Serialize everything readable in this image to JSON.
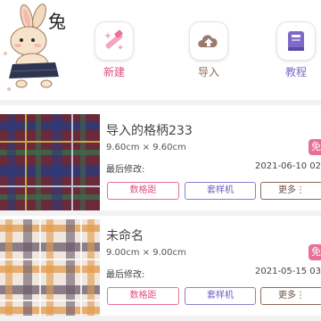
{
  "header": {
    "mascot_char": "兔",
    "actions": [
      {
        "label": "新建",
        "icon": "magic-wand-icon",
        "color": "#e0507d"
      },
      {
        "label": "导入",
        "icon": "cloud-upload-icon",
        "color": "#8b6a5a"
      },
      {
        "label": "教程",
        "icon": "book-icon",
        "color": "#7d6bc8"
      }
    ]
  },
  "cards": [
    {
      "title": "导入的格柄233",
      "size": "9.60cm × 9.60cm",
      "badge": "免",
      "modified_label": "最后修改:",
      "modified_date": "2021-06-10 02",
      "buttons": {
        "grid": "数格距",
        "mockup": "套样机",
        "more": "更多⋮"
      }
    },
    {
      "title": "未命名",
      "size": "9.00cm × 9.00cm",
      "badge": "免",
      "modified_label": "最后修改:",
      "modified_date": "2021-05-15 03",
      "buttons": {
        "grid": "数格距",
        "mockup": "套样机",
        "more": "更多⋮"
      }
    }
  ],
  "colors": {
    "pink": "#e86f95",
    "purple": "#8a7fd0",
    "brown": "#8b6a5a"
  }
}
